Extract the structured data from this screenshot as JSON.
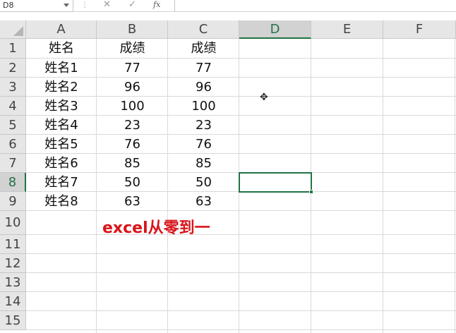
{
  "formula_bar": {
    "name_box": "D8",
    "cancel_icon": "✕",
    "enter_icon": "✓",
    "fx_label": "fx",
    "formula_value": ""
  },
  "columns": [
    "A",
    "B",
    "C",
    "D",
    "E",
    "F"
  ],
  "rows": [
    "1",
    "2",
    "3",
    "4",
    "5",
    "6",
    "7",
    "8",
    "9",
    "10",
    "11",
    "12",
    "13",
    "14",
    "15"
  ],
  "selected": {
    "column": "D",
    "row": "8"
  },
  "cells": {
    "A1": "姓名",
    "B1": "成绩",
    "C1": "成绩",
    "A2": "姓名1",
    "B2": "77",
    "C2": "77",
    "A3": "姓名2",
    "B3": "96",
    "C3": "96",
    "A4": "姓名3",
    "B4": "100",
    "C4": "100",
    "A5": "姓名4",
    "B5": "23",
    "C5": "23",
    "A6": "姓名5",
    "B6": "76",
    "C6": "76",
    "A7": "姓名6",
    "B7": "85",
    "C7": "85",
    "A8": "姓名7",
    "B8": "50",
    "C8": "50",
    "A9": "姓名8",
    "B9": "63",
    "C9": "63"
  },
  "annotation": "excel从零到一",
  "colors": {
    "selection": "#217346",
    "annotation": "#d9141a",
    "header_bg": "#e6e6e6",
    "gridline": "#d9d9d9"
  },
  "cursor_icon": "✥"
}
